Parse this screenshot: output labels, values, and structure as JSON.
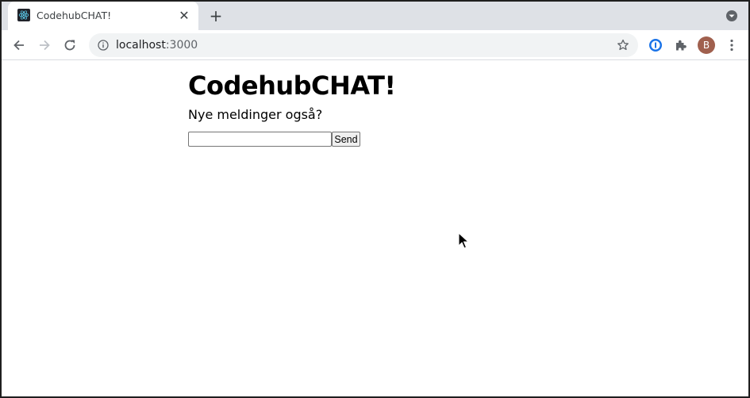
{
  "browser": {
    "tab": {
      "title": "CodehubCHAT!",
      "close_glyph": "✕",
      "favicon": "react-logo-icon"
    },
    "new_tab_glyph": "+",
    "address_bar": {
      "host": "localhost",
      "port": ":3000"
    },
    "profile_initial": "B",
    "colors": {
      "tab_strip": "#dee1e6",
      "omnibox": "#f1f3f4",
      "avatar": "#a0604e",
      "react_blue": "#61dafb"
    }
  },
  "page": {
    "title": "CodehubCHAT!",
    "subtitle": "Nye meldinger også?",
    "message_input_value": "",
    "send_label": "Send"
  }
}
